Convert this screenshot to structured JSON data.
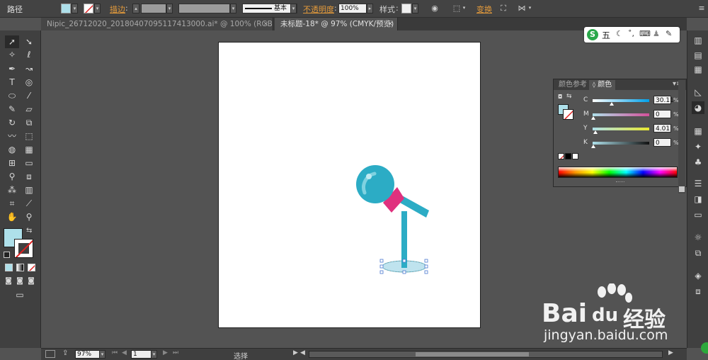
{
  "control_bar": {
    "object_type": "路径",
    "stroke_label": "描边",
    "stroke_style": "基本",
    "opacity_label": "不透明度",
    "opacity_value": "100%",
    "style_label": "样式",
    "transform_label": "变换"
  },
  "tabs": [
    {
      "label": "Nipic_26712020_20180407095117413000.ai* @ 100% (RGB/预览)",
      "close": "×"
    },
    {
      "label": "未标题-18* @ 97% (CMYK/预览)",
      "close": "×"
    }
  ],
  "color_panel": {
    "tabs": [
      "颜色参考",
      "颜色"
    ],
    "channels": [
      {
        "label": "C",
        "value": "30.11",
        "unit": "%",
        "fraction": 0.3
      },
      {
        "label": "M",
        "value": "0",
        "unit": "%",
        "fraction": 0.0
      },
      {
        "label": "Y",
        "value": "4.01",
        "unit": "%",
        "fraction": 0.04
      },
      {
        "label": "K",
        "value": "0",
        "unit": "%",
        "fraction": 0.0
      }
    ],
    "fill_color": "#aee0ea"
  },
  "status_bar": {
    "zoom": "97%",
    "page": "1",
    "tool": "选择"
  },
  "ime": {
    "mode": "五"
  },
  "watermark": {
    "brand_latin": "Bai",
    "brand_du": "du",
    "brand_cn": "经验",
    "url": "jingyan.baidu.com"
  },
  "colors": {
    "mic_head": "#2cacc5",
    "mic_band": "#e0317e",
    "base_fill": "#bfe3ee",
    "artboard": "#ffffff"
  }
}
